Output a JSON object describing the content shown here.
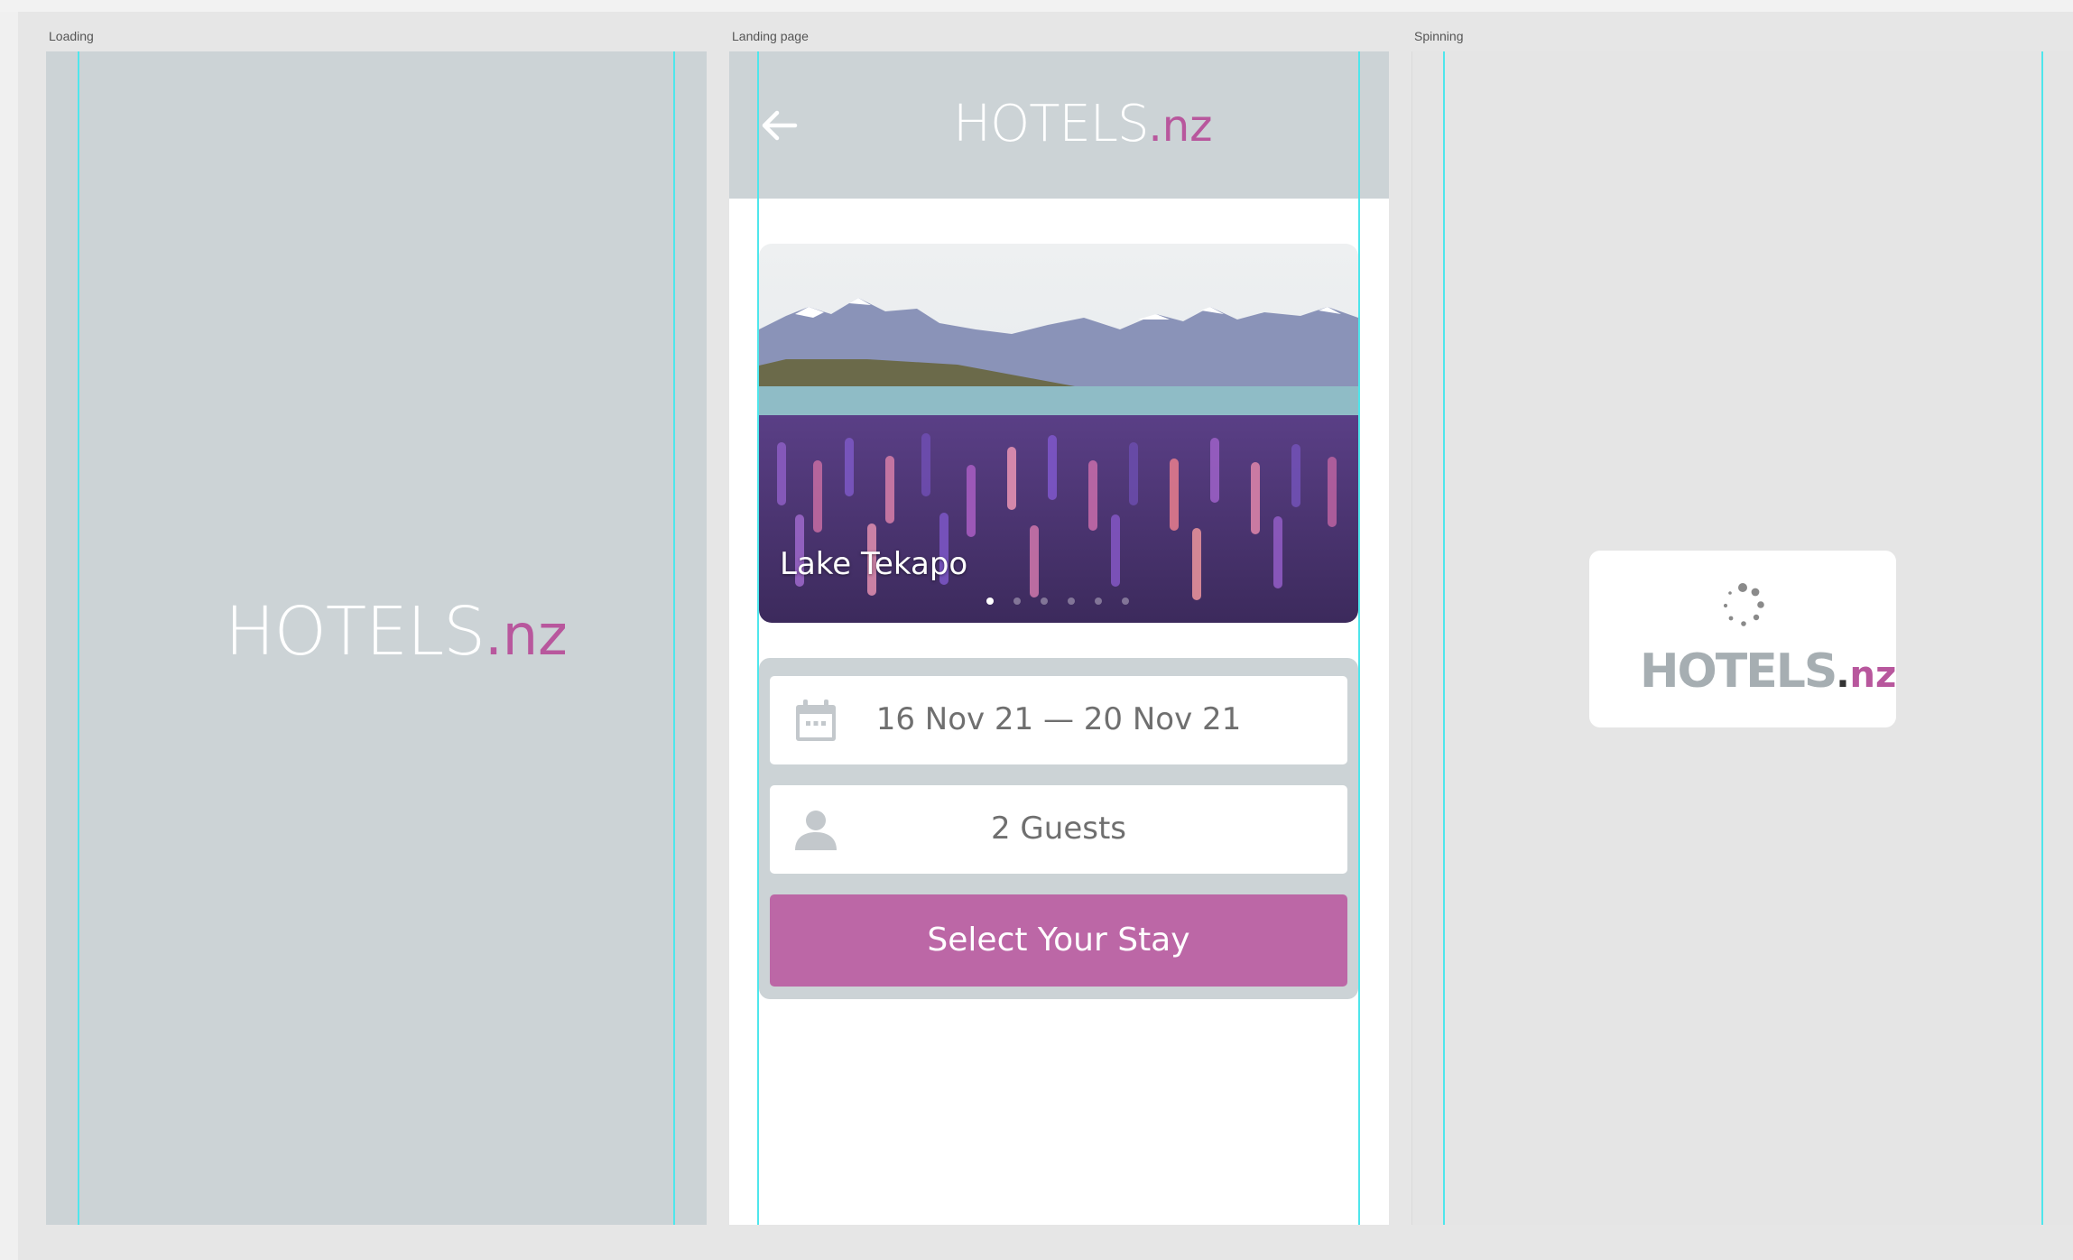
{
  "frames": {
    "loading": {
      "label": "Loading"
    },
    "landing": {
      "label": "Landing page"
    },
    "spinning": {
      "label": "Spinning"
    }
  },
  "brand": {
    "name": "HOTELS",
    "dot": ".",
    "tld": "nz",
    "accent_color": "#b8579d"
  },
  "landing": {
    "back_icon": "arrow-left-icon",
    "hero": {
      "title": "Lake Tekapo",
      "slides_count": 6,
      "active_slide": 1
    },
    "dates": {
      "icon": "calendar-icon",
      "value": "16 Nov 21 — 20 Nov 21"
    },
    "guests": {
      "icon": "person-icon",
      "value": "2 Guests"
    },
    "cta_label": "Select Your Stay"
  },
  "spinning": {
    "icon": "spinner-icon"
  },
  "colors": {
    "panel_gray": "#ccd3d6",
    "cta": "#bc67a6",
    "guide": "#4fe6ec"
  }
}
